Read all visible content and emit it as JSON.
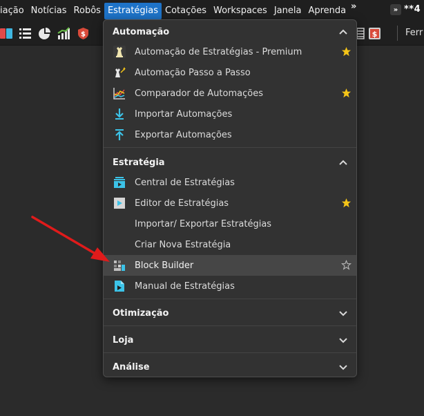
{
  "menubar": {
    "items": [
      "iação",
      "Notícias",
      "Robôs",
      "Estratégias",
      "Cotações",
      "Workspaces",
      "Janela",
      "Aprenda"
    ],
    "active_index": 3,
    "overflow": "»",
    "account_badge": "»",
    "account_text": "**4"
  },
  "toolbar": {
    "icons": [
      "book-icon",
      "list-icon",
      "pie-chart-icon",
      "signal-chart-icon",
      "shield-dollar-icon",
      "table-icon",
      "dollar-box-icon"
    ],
    "right_text": "Ferr"
  },
  "dropdown": {
    "sections": [
      {
        "title": "Automação",
        "expanded": true,
        "items": [
          {
            "label": "Automação de Estratégias - Premium",
            "icon": "chess-icon",
            "starred": true
          },
          {
            "label": "Automação Passo a Passo",
            "icon": "chess-wand-icon",
            "starred": false
          },
          {
            "label": "Comparador de Automações",
            "icon": "compare-chart-icon",
            "starred": true
          },
          {
            "label": "Importar Automações",
            "icon": "import-arrow-icon",
            "starred": false
          },
          {
            "label": "Exportar Automações",
            "icon": "export-arrow-icon",
            "starred": false
          }
        ]
      },
      {
        "title": "Estratégia",
        "expanded": true,
        "items": [
          {
            "label": "Central de Estratégias",
            "icon": "strategy-central-icon",
            "starred": false
          },
          {
            "label": "Editor de Estratégias",
            "icon": "strategy-editor-icon",
            "starred": true
          },
          {
            "label": "Importar/ Exportar Estratégias",
            "icon": "",
            "starred": false
          },
          {
            "label": "Criar Nova Estratégia",
            "icon": "",
            "starred": false
          },
          {
            "label": "Block Builder",
            "icon": "block-builder-icon",
            "starred": false,
            "star_outline": true,
            "hovered": true
          },
          {
            "label": "Manual de Estratégias",
            "icon": "manual-icon",
            "starred": false
          }
        ]
      },
      {
        "title": "Otimização",
        "expanded": false
      },
      {
        "title": "Loja",
        "expanded": false
      },
      {
        "title": "Análise",
        "expanded": false
      }
    ]
  },
  "colors": {
    "accent": "#1e73c8",
    "star": "#f5c518",
    "arrow": "#e01b1b",
    "icon_cyan": "#3cc3e8"
  }
}
